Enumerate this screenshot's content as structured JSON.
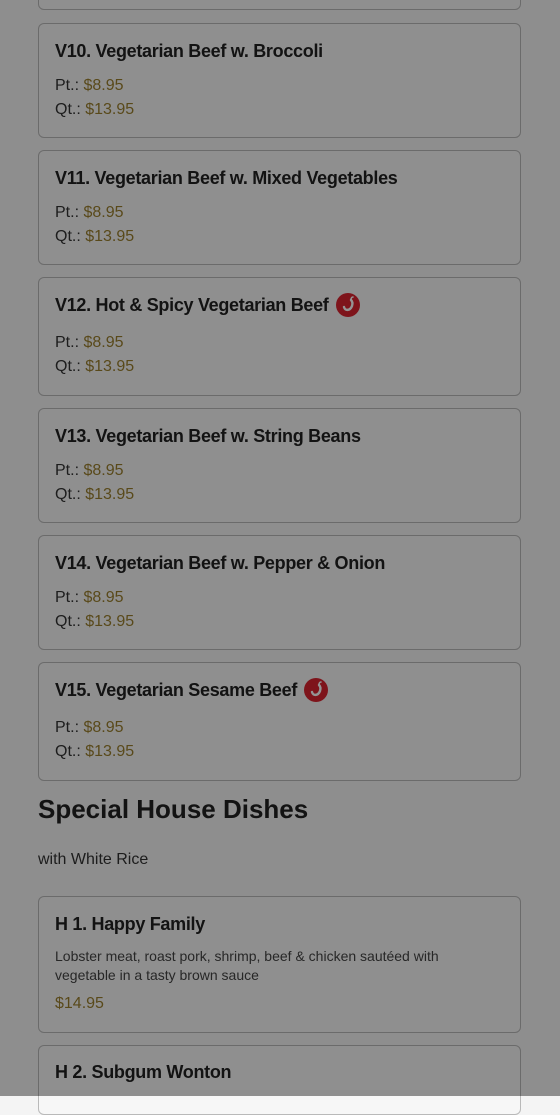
{
  "items": [
    {
      "name": "V10. Vegetarian Beef w. Broccoli",
      "pt_label": "Pt.:",
      "pt_price": "$8.95",
      "qt_label": "Qt.:",
      "qt_price": "$13.95",
      "spicy": false
    },
    {
      "name": "V11. Vegetarian Beef w. Mixed Vegetables",
      "pt_label": "Pt.:",
      "pt_price": "$8.95",
      "qt_label": "Qt.:",
      "qt_price": "$13.95",
      "spicy": false
    },
    {
      "name": "V12. Hot & Spicy Vegetarian Beef",
      "pt_label": "Pt.:",
      "pt_price": "$8.95",
      "qt_label": "Qt.:",
      "qt_price": "$13.95",
      "spicy": true
    },
    {
      "name": "V13. Vegetarian Beef w. String Beans",
      "pt_label": "Pt.:",
      "pt_price": "$8.95",
      "qt_label": "Qt.:",
      "qt_price": "$13.95",
      "spicy": false
    },
    {
      "name": "V14. Vegetarian Beef w. Pepper & Onion",
      "pt_label": "Pt.:",
      "pt_price": "$8.95",
      "qt_label": "Qt.:",
      "qt_price": "$13.95",
      "spicy": false
    },
    {
      "name": "V15. Vegetarian Sesame Beef",
      "pt_label": "Pt.:",
      "pt_price": "$8.95",
      "qt_label": "Qt.:",
      "qt_price": "$13.95",
      "spicy": true
    }
  ],
  "section": {
    "title": "Special House Dishes",
    "subtitle": "with White Rice"
  },
  "house_items": [
    {
      "name": "H 1. Happy Family",
      "description": "Lobster meat, roast pork, shrimp, beef & chicken sautéed with vegetable in a tasty brown sauce",
      "price": "$14.95"
    },
    {
      "name": "H 2. Subgum Wonton"
    }
  ],
  "icons": {
    "spicy": "chili-pepper-icon"
  },
  "colors": {
    "price": "#9a7f2d",
    "spicy_badge": "#d9232f",
    "overlay": "rgba(0,0,0,0.42)"
  }
}
